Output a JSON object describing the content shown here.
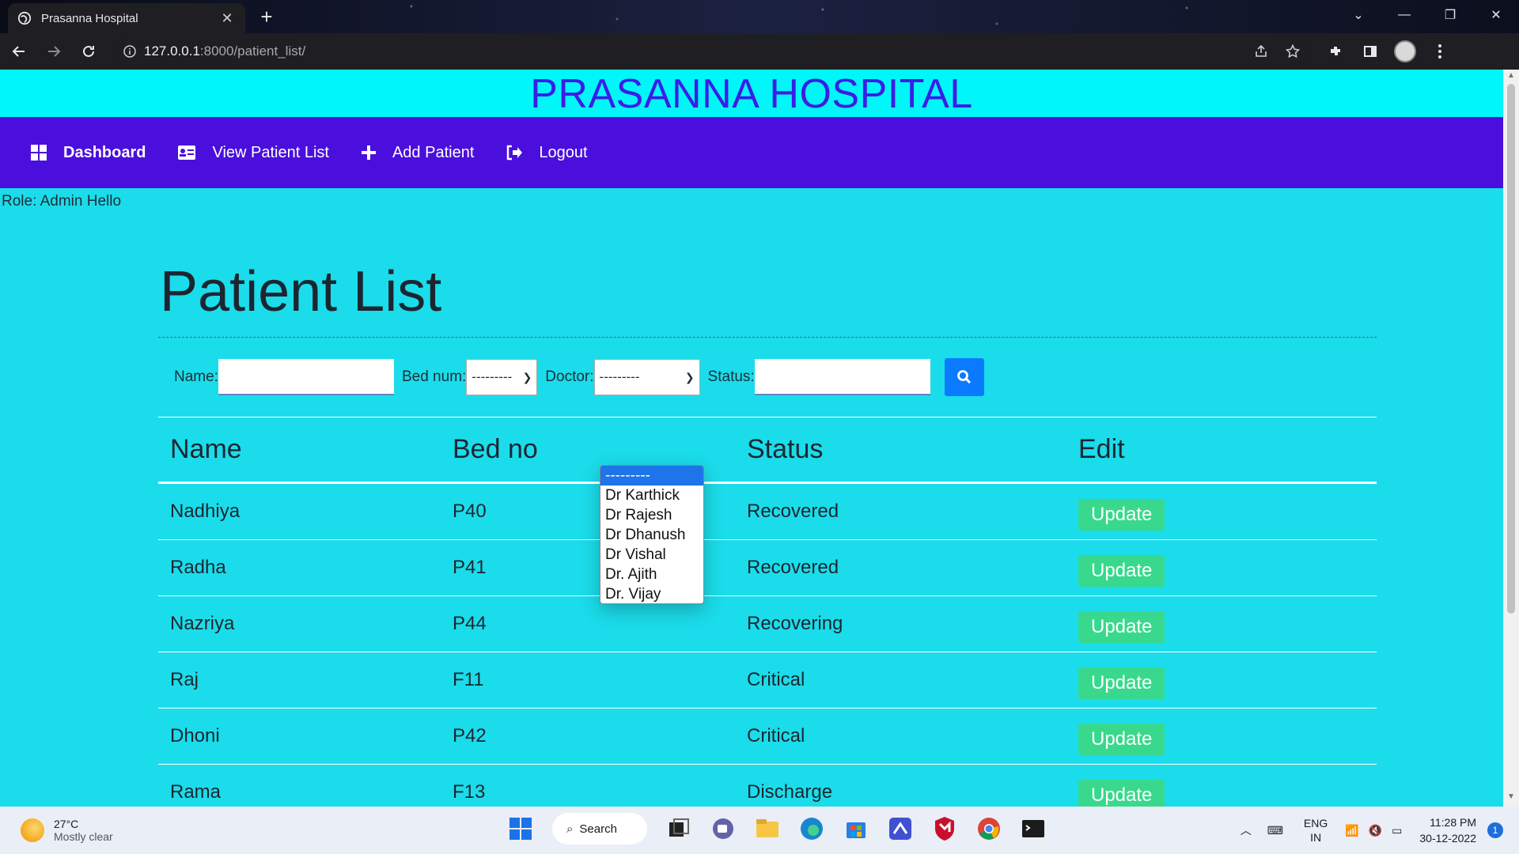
{
  "browser": {
    "tab_title": "Prasanna Hospital",
    "url_host": "127.0.0.1",
    "url_path": ":8000/patient_list/"
  },
  "site": {
    "header_title": "PRASANNA HOSPITAL",
    "nav": [
      {
        "label": "Dashboard",
        "icon": "dashboard-grid-icon"
      },
      {
        "label": "View Patient List",
        "icon": "id-card-icon"
      },
      {
        "label": "Add Patient",
        "icon": "plus-icon"
      },
      {
        "label": "Logout",
        "icon": "sign-out-icon"
      }
    ],
    "role_text": "Role: Admin Hello"
  },
  "page": {
    "title": "Patient List",
    "filters": {
      "name_label": "Name:",
      "bed_label": "Bed num:",
      "bed_selected": "---------",
      "doctor_label": "Doctor:",
      "doctor_selected": "---------",
      "status_label": "Status:"
    },
    "doctor_options": [
      "---------",
      "Dr Karthick",
      "Dr Rajesh",
      "Dr Dhanush",
      "Dr Vishal",
      "Dr. Ajith",
      "Dr. Vijay"
    ],
    "table": {
      "headers": [
        "Name",
        "Bed no",
        "Status",
        "Edit"
      ],
      "update_label": "Update",
      "rows": [
        {
          "name": "Nadhiya",
          "bed": "P40",
          "status": "Recovered"
        },
        {
          "name": "Radha",
          "bed": "P41",
          "status": "Recovered"
        },
        {
          "name": "Nazriya",
          "bed": "P44",
          "status": "Recovering"
        },
        {
          "name": "Raj",
          "bed": "F11",
          "status": "Critical"
        },
        {
          "name": "Dhoni",
          "bed": "P42",
          "status": "Critical"
        },
        {
          "name": "Rama",
          "bed": "F13",
          "status": "Discharge"
        }
      ]
    }
  },
  "taskbar": {
    "weather_temp": "27°C",
    "weather_cond": "Mostly clear",
    "search_label": "Search",
    "lang_1": "ENG",
    "lang_2": "IN",
    "time": "11:28 PM",
    "date": "30-12-2022",
    "notif_count": "1"
  },
  "colors": {
    "header_bg": "#00f7fa",
    "header_text": "#3a1ee6",
    "nav_bg": "#4a0fdc",
    "page_bg": "#1bdcea",
    "update_btn": "#38d98c",
    "search_btn": "#0a7bff"
  }
}
